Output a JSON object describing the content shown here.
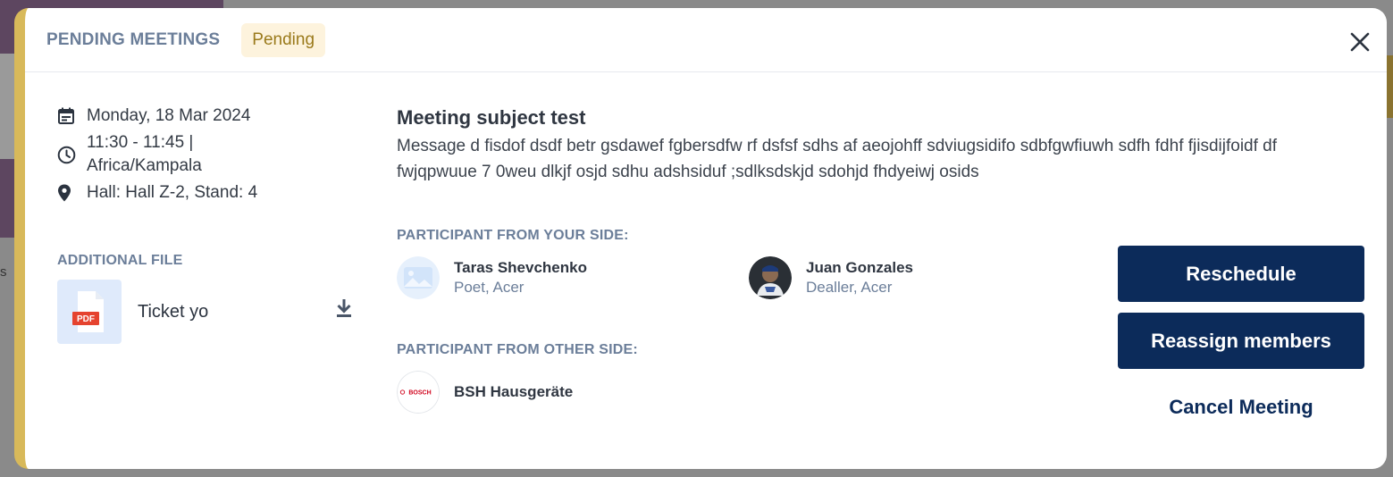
{
  "modal": {
    "title": "PENDING MEETINGS",
    "status": "Pending"
  },
  "details": {
    "date": "Monday, 18 Mar 2024",
    "time": "11:30 - 11:45 |",
    "timezone": "Africa/Kampala",
    "location": "Hall: Hall Z-2, Stand: 4"
  },
  "additional_file": {
    "label": "ADDITIONAL FILE",
    "file_type": "PDF",
    "file_name": "Ticket yo"
  },
  "meeting": {
    "subject": "Meeting subject test",
    "message": "Message d fisdof dsdf betr gsdawef fgbersdfw rf dsfsf sdhs af aeojohff sdviugsidifo sdbfgwfiuwh sdfh fdhf fjisdijfoidf df fwjqpwuue 7 0weu dlkjf osjd sdhu adshsiduf ;sdlksdskjd sdohjd fhdyeiwj osids"
  },
  "your_side": {
    "label": "PARTICIPANT FROM YOUR SIDE:",
    "participants": [
      {
        "name": "Taras Shevchenko",
        "role": "Poet, Acer"
      },
      {
        "name": "Juan Gonzales",
        "role": "Dealler, Acer"
      }
    ]
  },
  "other_side": {
    "label": "PARTICIPANT FROM OTHER SIDE:",
    "participants": [
      {
        "name": "BSH Hausgeräte",
        "logo_text": "BOSCH"
      }
    ]
  },
  "actions": {
    "reschedule": "Reschedule",
    "reassign": "Reassign members",
    "cancel": "Cancel Meeting"
  },
  "backdrop": {
    "fragment": "s"
  },
  "colors": {
    "accent_bar": "#d8b95a",
    "primary_button": "#0c2b5a",
    "badge_bg": "#fdf3dd",
    "badge_text": "#9a7a1b",
    "label_text": "#6b7e99"
  }
}
